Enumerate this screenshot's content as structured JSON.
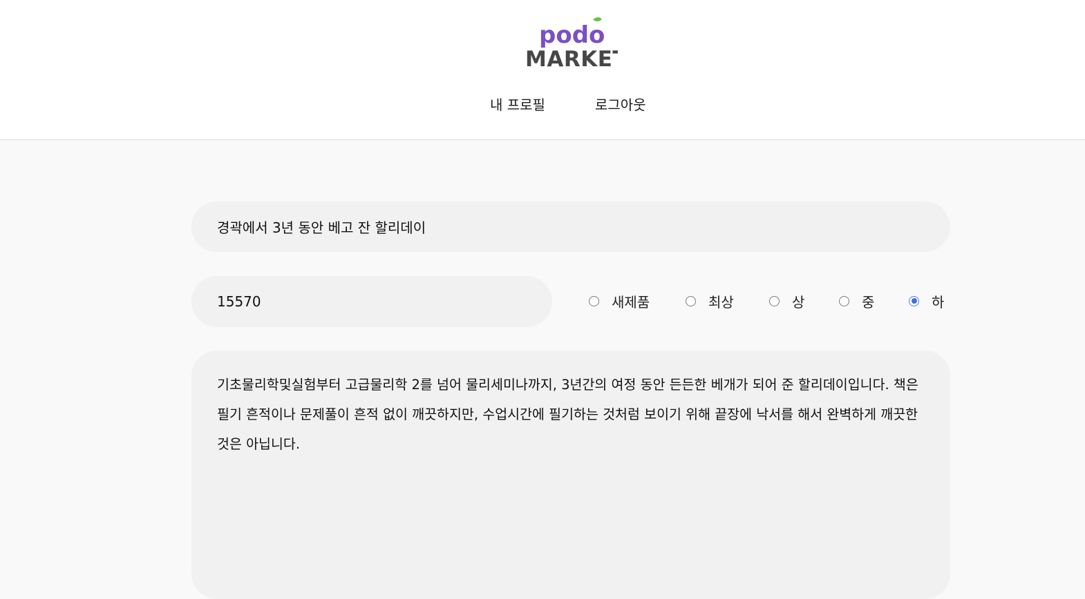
{
  "header": {
    "logo_top": "podo",
    "logo_bottom": "MARKET",
    "nav": {
      "profile": "내 프로필",
      "logout": "로그아웃"
    }
  },
  "form": {
    "title_value": "경곽에서 3년 동안 베고 잔 할리데이",
    "price_value": "15570",
    "conditions": [
      "새제품",
      "최상",
      "상",
      "중",
      "하"
    ],
    "selected_condition": "하",
    "description": "기초물리학및실험부터 고급물리학 2를 넘어 물리세미나까지, 3년간의 여정 동안 든든한 베개가 되어 준 할리데이입니다. 책은 필기 흔적이나 문제풀이 흔적 없이 깨끗하지만, 수업시간에 필기하는 것처럼 보이기 위해 끝장에 낙서를 해서 완벽하게 깨끗한 것은 아닙니다."
  },
  "colors": {
    "brand_purple": "#7b4fc4",
    "leaf_green": "#6cc04a",
    "radio_selected": "#3b6fe8"
  }
}
